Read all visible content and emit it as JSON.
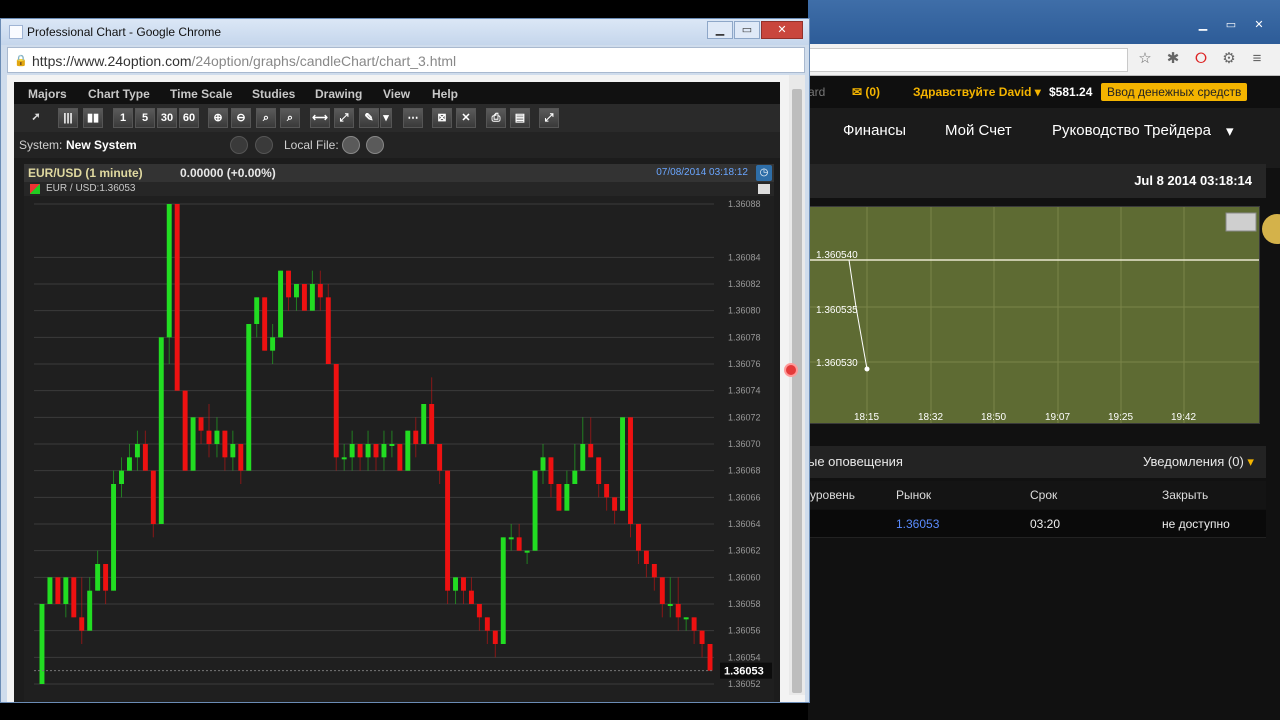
{
  "popup": {
    "title": "Professional Chart - Google Chrome",
    "url_host": "https://www.24option.com",
    "url_path": "/24option/graphs/candleChart/chart_3.html",
    "menu": [
      "Majors",
      "Chart Type",
      "Time Scale",
      "Studies",
      "Drawing",
      "View",
      "Help"
    ],
    "timeframes": [
      "1",
      "5",
      "30",
      "60"
    ],
    "system_label": "System:",
    "system_value": "New System",
    "local_file_label": "Local File:",
    "symbol": "EUR/USD (1 minute)",
    "change": "0.00000 (+0.00%)",
    "timestamp": "07/08/2014 03:18:12",
    "sub_label": "EUR / USD:1.36053",
    "current_price": "1.36053"
  },
  "chart_data": {
    "type": "candlestick",
    "ylim": [
      1.36052,
      1.36088
    ],
    "yticks": [
      "1.36088",
      "1.36084",
      "1.36082",
      "1.36080",
      "1.36078",
      "1.36076",
      "1.36074",
      "1.36072",
      "1.36070",
      "1.36068",
      "1.36066",
      "1.36064",
      "1.36062",
      "1.36060",
      "1.36058",
      "1.36056",
      "1.36054",
      "1.36052"
    ],
    "colors": {
      "up": "#22dd22",
      "down": "#ee1111"
    },
    "candles": [
      [
        1.36052,
        1.36058,
        1.36052,
        1.36058
      ],
      [
        1.36058,
        1.3606,
        1.36058,
        1.3606
      ],
      [
        1.3606,
        1.3606,
        1.36058,
        1.36058
      ],
      [
        1.36058,
        1.3606,
        1.36057,
        1.3606
      ],
      [
        1.3606,
        1.3606,
        1.36057,
        1.36057
      ],
      [
        1.36057,
        1.3606,
        1.36055,
        1.36056
      ],
      [
        1.36056,
        1.3606,
        1.36056,
        1.36059
      ],
      [
        1.36059,
        1.36062,
        1.36059,
        1.36061
      ],
      [
        1.36061,
        1.36061,
        1.36058,
        1.36059
      ],
      [
        1.36059,
        1.36068,
        1.36059,
        1.36067
      ],
      [
        1.36067,
        1.36069,
        1.36066,
        1.36068
      ],
      [
        1.36068,
        1.3607,
        1.36068,
        1.36069
      ],
      [
        1.36069,
        1.36071,
        1.36068,
        1.3607
      ],
      [
        1.3607,
        1.36071,
        1.36068,
        1.36068
      ],
      [
        1.36068,
        1.36068,
        1.36063,
        1.36064
      ],
      [
        1.36064,
        1.36078,
        1.36064,
        1.36078
      ],
      [
        1.36078,
        1.36088,
        1.36076,
        1.36088
      ],
      [
        1.36088,
        1.36088,
        1.36074,
        1.36074
      ],
      [
        1.36074,
        1.36074,
        1.36068,
        1.36068
      ],
      [
        1.36068,
        1.36072,
        1.36068,
        1.36072
      ],
      [
        1.36072,
        1.36072,
        1.3607,
        1.36071
      ],
      [
        1.36071,
        1.36073,
        1.36069,
        1.3607
      ],
      [
        1.3607,
        1.36072,
        1.36069,
        1.36071
      ],
      [
        1.36071,
        1.36071,
        1.36068,
        1.36069
      ],
      [
        1.36069,
        1.36071,
        1.36068,
        1.3607
      ],
      [
        1.3607,
        1.3607,
        1.36067,
        1.36068
      ],
      [
        1.36068,
        1.36079,
        1.36068,
        1.36079
      ],
      [
        1.36079,
        1.36081,
        1.36078,
        1.36081
      ],
      [
        1.36081,
        1.36081,
        1.36077,
        1.36077
      ],
      [
        1.36077,
        1.36079,
        1.36076,
        1.36078
      ],
      [
        1.36078,
        1.36083,
        1.36078,
        1.36083
      ],
      [
        1.36083,
        1.36083,
        1.3608,
        1.36081
      ],
      [
        1.36081,
        1.36082,
        1.3608,
        1.36082
      ],
      [
        1.36082,
        1.36082,
        1.3608,
        1.3608
      ],
      [
        1.3608,
        1.36083,
        1.3608,
        1.36082
      ],
      [
        1.36082,
        1.36083,
        1.3608,
        1.36081
      ],
      [
        1.36081,
        1.36082,
        1.36076,
        1.36076
      ],
      [
        1.36076,
        1.36076,
        1.36068,
        1.36069
      ],
      [
        1.36069,
        1.3607,
        1.36068,
        1.36069
      ],
      [
        1.36069,
        1.36071,
        1.36068,
        1.3607
      ],
      [
        1.3607,
        1.3607,
        1.36068,
        1.36069
      ],
      [
        1.36069,
        1.36071,
        1.36068,
        1.3607
      ],
      [
        1.3607,
        1.3607,
        1.36068,
        1.36069
      ],
      [
        1.36069,
        1.36071,
        1.36068,
        1.3607
      ],
      [
        1.3607,
        1.36071,
        1.36069,
        1.3607
      ],
      [
        1.3607,
        1.3607,
        1.36068,
        1.36068
      ],
      [
        1.36068,
        1.36071,
        1.36068,
        1.36071
      ],
      [
        1.36071,
        1.36072,
        1.36069,
        1.3607
      ],
      [
        1.3607,
        1.36073,
        1.3607,
        1.36073
      ],
      [
        1.36073,
        1.36075,
        1.3607,
        1.3607
      ],
      [
        1.3607,
        1.3607,
        1.36067,
        1.36068
      ],
      [
        1.36068,
        1.36068,
        1.36058,
        1.36059
      ],
      [
        1.36059,
        1.3606,
        1.36058,
        1.3606
      ],
      [
        1.3606,
        1.3606,
        1.36058,
        1.36059
      ],
      [
        1.36059,
        1.3606,
        1.36058,
        1.36058
      ],
      [
        1.36058,
        1.36058,
        1.36056,
        1.36057
      ],
      [
        1.36057,
        1.36057,
        1.36055,
        1.36056
      ],
      [
        1.36056,
        1.36056,
        1.36054,
        1.36055
      ],
      [
        1.36055,
        1.36063,
        1.36055,
        1.36063
      ],
      [
        1.36063,
        1.36064,
        1.36062,
        1.36063
      ],
      [
        1.36063,
        1.36064,
        1.36062,
        1.36062
      ],
      [
        1.36062,
        1.36062,
        1.36061,
        1.36062
      ],
      [
        1.36062,
        1.36068,
        1.36062,
        1.36068
      ],
      [
        1.36068,
        1.3607,
        1.36067,
        1.36069
      ],
      [
        1.36069,
        1.36069,
        1.36066,
        1.36067
      ],
      [
        1.36067,
        1.36067,
        1.36065,
        1.36065
      ],
      [
        1.36065,
        1.36068,
        1.36065,
        1.36067
      ],
      [
        1.36067,
        1.3607,
        1.36067,
        1.36068
      ],
      [
        1.36068,
        1.36072,
        1.36068,
        1.3607
      ],
      [
        1.3607,
        1.36072,
        1.36069,
        1.36069
      ],
      [
        1.36069,
        1.36069,
        1.36066,
        1.36067
      ],
      [
        1.36067,
        1.36067,
        1.36065,
        1.36066
      ],
      [
        1.36066,
        1.36066,
        1.36064,
        1.36065
      ],
      [
        1.36065,
        1.36072,
        1.36065,
        1.36072
      ],
      [
        1.36072,
        1.36072,
        1.36063,
        1.36064
      ],
      [
        1.36064,
        1.36064,
        1.36061,
        1.36062
      ],
      [
        1.36062,
        1.36062,
        1.3606,
        1.36061
      ],
      [
        1.36061,
        1.36061,
        1.36059,
        1.3606
      ],
      [
        1.3606,
        1.3606,
        1.36057,
        1.36058
      ],
      [
        1.36058,
        1.3606,
        1.36057,
        1.36058
      ],
      [
        1.36058,
        1.3606,
        1.36056,
        1.36057
      ],
      [
        1.36057,
        1.36057,
        1.36056,
        1.36057
      ],
      [
        1.36057,
        1.36057,
        1.36055,
        1.36056
      ],
      [
        1.36056,
        1.36056,
        1.36054,
        1.36055
      ],
      [
        1.36055,
        1.36055,
        1.36053,
        1.36053
      ]
    ]
  },
  "background": {
    "account_link": "ard",
    "messages": "(0)",
    "greeting": "Здравствуйте David",
    "balance": "$581.24",
    "deposit": "Ввод денежных средств",
    "nav": [
      "Финансы",
      "Мой Счет",
      "Руководство Трейдера"
    ],
    "datetime": "Jul 8 2014  03:18:14",
    "mini_prices": [
      "1.360540",
      "1.360535",
      "1.360530"
    ],
    "mini_times": [
      "18:15",
      "18:32",
      "18:50",
      "19:07",
      "19:25",
      "19:42"
    ],
    "alerts_left": "ые оповещения",
    "alerts_right": "Уведомления (0)",
    "table_headers": [
      "уровень",
      "Рынок",
      "Срок",
      "Закрыть"
    ],
    "table_row": [
      "",
      "1.36053",
      "03:20",
      "не доступно"
    ]
  }
}
